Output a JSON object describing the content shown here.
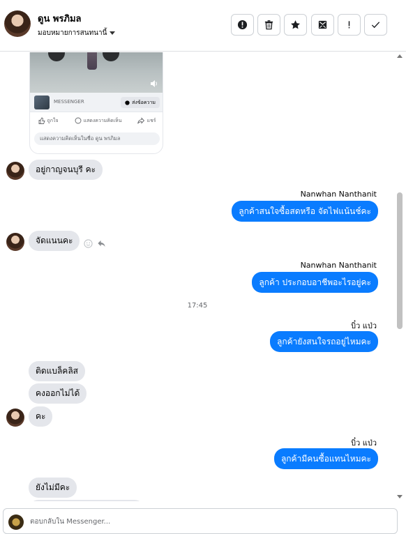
{
  "header": {
    "contact_name": "ดูน พรภิมล",
    "assign_label": "มอบหมายการสนทนานี้",
    "toolbar": [
      {
        "name": "spam-button",
        "icon": "alert-circle-icon"
      },
      {
        "name": "delete-button",
        "icon": "trash-icon"
      },
      {
        "name": "star-button",
        "icon": "star-icon"
      },
      {
        "name": "mark-unread-button",
        "icon": "mail-open-icon"
      },
      {
        "name": "follow-up-button",
        "icon": "exclamation-icon"
      },
      {
        "name": "done-button",
        "icon": "check-icon"
      }
    ]
  },
  "post_card": {
    "source": "MESSENGER",
    "send_label": "ส่งข้อความ",
    "actions": {
      "like": "ถูกใจ",
      "comment": "แสดงความคิดเห็น",
      "share": "แชร์"
    },
    "comment_placeholder": "แสดงความคิดเห็นในชื่อ ดูน พรภิมล"
  },
  "messages": [
    {
      "direction": "in",
      "text": "อยู่กาญจนบุรี คะ"
    },
    {
      "direction": "out",
      "sender": "Nanwhan Nanthanit",
      "text": "ลูกค้าสนใจซื้อสดหรือ จัดไฟแน้นช์คะ"
    },
    {
      "direction": "in",
      "text": "จัดแนนคะ"
    },
    {
      "direction": "out",
      "sender": "Nanwhan Nanthanit",
      "text": "ลูกค้า ประกอบอาชีพอะไรอยู่คะ"
    },
    {
      "direction": "out",
      "sender": "บิ๋ว แป่ว",
      "text": "ลูกค้ายังสนใจรถอยู่ไหมคะ"
    },
    {
      "direction": "in",
      "text": "ติดแบล็คลิส"
    },
    {
      "direction": "in",
      "text": "คงออกไม่ได้"
    },
    {
      "direction": "in",
      "text": "คะ"
    },
    {
      "direction": "out",
      "sender": "บิ๋ว แป่ว",
      "text": "ลูกค้ามีคนซื้อแทนไหมคะ"
    },
    {
      "direction": "in",
      "text": "ยังไม่มีคะ"
    }
  ],
  "timestamp": "17:45",
  "composer": {
    "placeholder": "ตอบกลับใน Messenger..."
  },
  "colors": {
    "outgoing_bubble": "#0a7cff",
    "incoming_bubble": "#e4e6eb"
  }
}
